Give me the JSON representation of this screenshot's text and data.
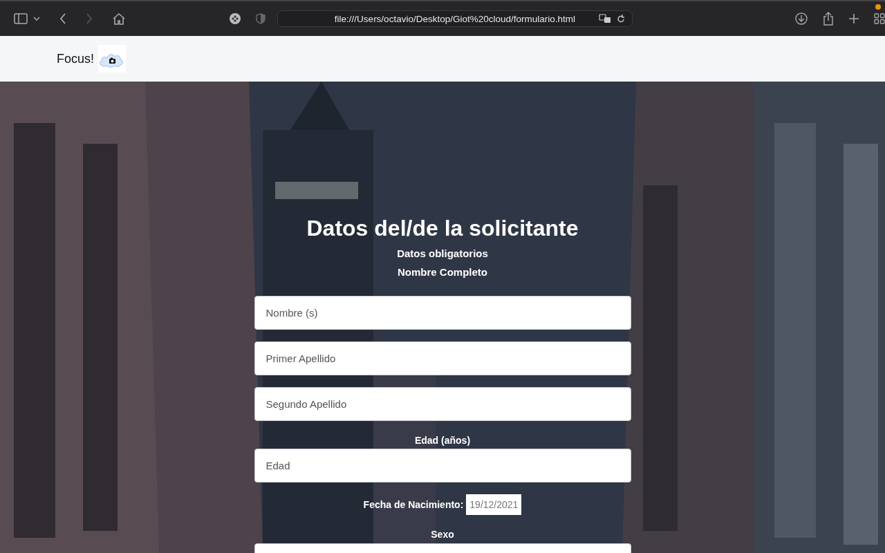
{
  "browser": {
    "address": "file:///Users/octavio/Desktop/Giot%20cloud/formulario.html"
  },
  "navbar": {
    "brand": "Focus!"
  },
  "form": {
    "title": "Datos del/de la solicitante",
    "subtitle": "Datos obligatorios",
    "name_label": "Nombre Completo",
    "name_fields": [
      {
        "placeholder": "Nombre (s)"
      },
      {
        "placeholder": "Primer Apellido"
      },
      {
        "placeholder": "Segundo Apellido"
      }
    ],
    "age_label": "Edad (años)",
    "age_field": {
      "placeholder": "Edad"
    },
    "birth_label": "Fecha de Nacimiento:",
    "birth_date": {
      "value": "19/12/2021"
    },
    "sex_label": "Sexo"
  }
}
